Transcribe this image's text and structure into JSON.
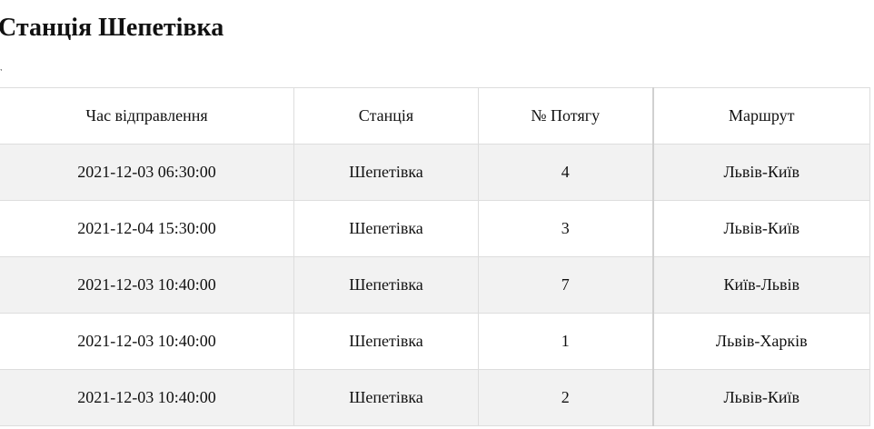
{
  "page": {
    "title": "Станція Шепетівка",
    "mark": ","
  },
  "table": {
    "headers": [
      "Час відправлення",
      "Станція",
      "№ Потягу",
      "Маршрут"
    ],
    "rows": [
      [
        "2021-12-03 06:30:00",
        "Шепетівка",
        "4",
        "Львів-Київ"
      ],
      [
        "2021-12-04 15:30:00",
        "Шепетівка",
        "3",
        "Львів-Київ"
      ],
      [
        "2021-12-03 10:40:00",
        "Шепетівка",
        "7",
        "Київ-Львів"
      ],
      [
        "2021-12-03 10:40:00",
        "Шепетівка",
        "1",
        "Львів-Харків"
      ],
      [
        "2021-12-03 10:40:00",
        "Шепетівка",
        "2",
        "Львів-Київ"
      ]
    ]
  },
  "colors": {
    "stripe_row": "#f2f2f2",
    "plain_row": "#ffffff",
    "border": "#dddddd",
    "text": "#111111"
  }
}
